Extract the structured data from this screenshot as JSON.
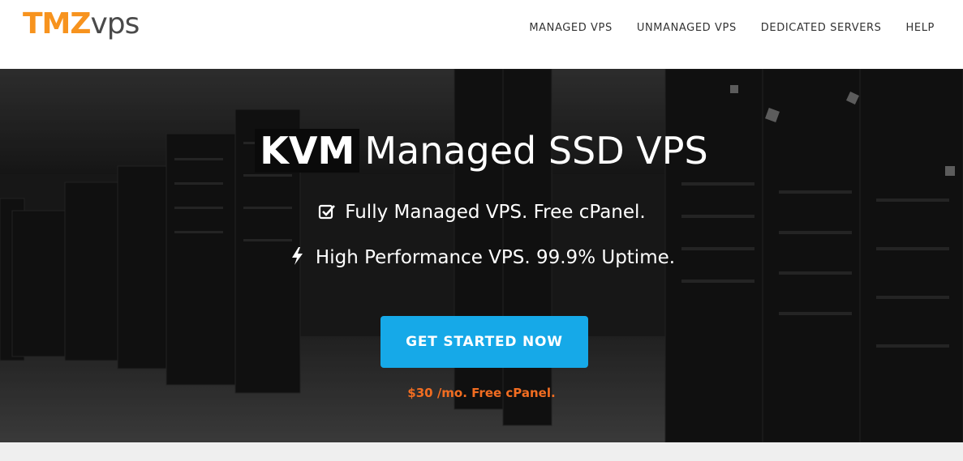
{
  "brand": {
    "logo_text_tmz": "TMZ",
    "logo_text_vps": "vps",
    "colors": {
      "orange": "#f7931e",
      "blue": "#29abe2",
      "gray": "#4a4a4a"
    }
  },
  "nav": {
    "items": [
      "MANAGED VPS",
      "UNMANAGED VPS",
      "DEDICATED SERVERS",
      "HELP"
    ]
  },
  "hero": {
    "title_highlight": "KVM",
    "title_rest": "Managed SSD VPS",
    "features": [
      {
        "icon": "checkbox-icon",
        "text": "Fully Managed VPS. Free cPanel."
      },
      {
        "icon": "lightning-icon",
        "text": "High Performance VPS. 99.9% Uptime."
      }
    ],
    "cta_label": "GET STARTED NOW",
    "price_text": "$30 /mo. Free cPanel.",
    "colors": {
      "cta": "#16a9e8",
      "price": "#f26d21"
    }
  }
}
